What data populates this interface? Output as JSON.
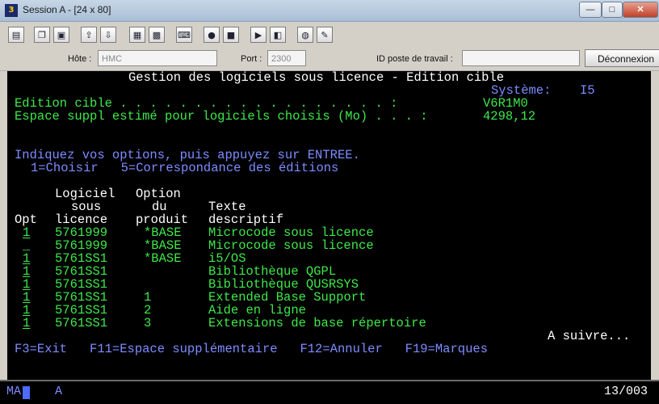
{
  "window": {
    "icon_text": "3⃞",
    "title": "Session A - [24 x 80]",
    "minimize": "—",
    "maximize": "□",
    "close": "✕"
  },
  "toolbar": {
    "icons": [
      "print-screen-icon",
      "copy-icon",
      "paste-icon",
      "send-icon",
      "receive-icon",
      "display-icon",
      "keyboard-icon",
      "macro-record-icon",
      "macro-play-icon",
      "play-icon",
      "stop-icon",
      "globe-icon",
      "pencil-icon"
    ]
  },
  "hostbar": {
    "host_label": "Hôte :",
    "host_value": "HMC",
    "port_label": "Port :",
    "port_value": "2300",
    "workstation_label": "ID poste de travail :",
    "workstation_value": "",
    "disconnect_label": "Déconnexion"
  },
  "screen": {
    "title": "Gestion des logiciels sous licence - Edition cible",
    "system_label": "Système:",
    "system_value": "I5",
    "target_label": "Edition cible . . . . . . . . . . . . . . . . . . :",
    "target_value": "V6R1M0",
    "space_label": "Espace suppl estimé pour logiciels choisis (Mo) . . . :",
    "space_value": "4298,12",
    "instruction": "Indiquez vos options, puis appuyez sur ENTREE.",
    "options_line": "1=Choisir   5=Correspondance des éditions",
    "headers": {
      "logiciel1": "Logiciel",
      "logiciel2": "sous",
      "logiciel3": "licence",
      "option1": "Option",
      "option2": "du",
      "option3": "produit",
      "texte1": "Texte",
      "texte2": "descriptif",
      "opt": "Opt"
    },
    "rows": [
      {
        "opt": "1",
        "product": "5761999",
        "option": "*BASE",
        "text": "Microcode sous licence"
      },
      {
        "opt": "_",
        "product": "5761999",
        "option": "*BASE",
        "text": "Microcode sous licence"
      },
      {
        "opt": "1",
        "product": "5761SS1",
        "option": "*BASE",
        "text": "i5/OS"
      },
      {
        "opt": "1",
        "product": "5761SS1",
        "option": "",
        "text": "Bibliothèque QGPL"
      },
      {
        "opt": "1",
        "product": "5761SS1",
        "option": "",
        "text": "Bibliothèque QUSRSYS"
      },
      {
        "opt": "1",
        "product": "5761SS1",
        "option": "1",
        "text": "Extended Base Support"
      },
      {
        "opt": "1",
        "product": "5761SS1",
        "option": "2",
        "text": "Aide en ligne"
      },
      {
        "opt": "1",
        "product": "5761SS1",
        "option": "3",
        "text": "Extensions de base répertoire"
      }
    ],
    "more": "A suivre...",
    "function_keys": "F3=Exit   F11=Espace supplémentaire   F12=Annuler   F19=Marques"
  },
  "status": {
    "ma": "MA",
    "mode": "A",
    "position": "13/003"
  }
}
